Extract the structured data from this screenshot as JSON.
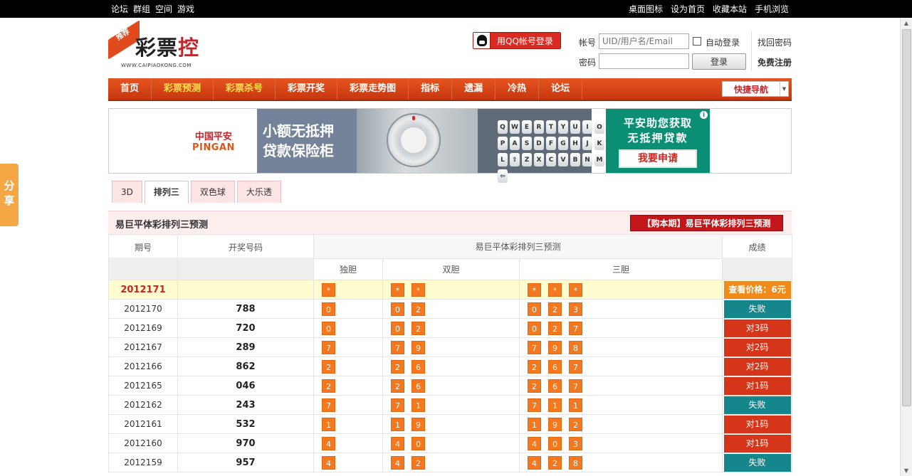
{
  "topbar": {
    "left": [
      "论坛",
      "群组",
      "空间",
      "游戏"
    ],
    "right": [
      "桌面图标",
      "设为首页",
      "收藏本站",
      "手机浏览"
    ]
  },
  "logo": {
    "badge": "推荐",
    "name_a": "彩票",
    "name_b": "控",
    "url": "WWW.CAIPIAOKONG.COM"
  },
  "login": {
    "qq_label": "用QQ帐号登录",
    "account_label": "帐号",
    "account_placeholder": "UID/用户名/Email",
    "password_label": "密码",
    "auto_login": "自动登录",
    "login_button": "登录",
    "find_password": "找回密码",
    "register": "免费注册"
  },
  "nav": {
    "items": [
      "首页",
      "彩票预测",
      "彩票杀号",
      "彩票开奖",
      "彩票走势图",
      "指标",
      "遗漏",
      "冷热",
      "论坛"
    ],
    "quick_nav": "快捷导航"
  },
  "banner": {
    "logo_cn": "中国平安",
    "logo_en": "PINGAN",
    "slogan_1": "小额无抵押",
    "slogan_2": "贷款保险柜",
    "keys": [
      "Q",
      "W",
      "E",
      "R",
      "T",
      "Y",
      "U",
      "I",
      "O",
      "P",
      "A",
      "S",
      "D",
      "F",
      "G",
      "H",
      "J",
      "K",
      "L",
      "⇧",
      "Z",
      "X",
      "C",
      "V",
      "B",
      "N",
      "M",
      "⇦"
    ],
    "cta_1": "平安助您获取",
    "cta_2": "无抵押贷款",
    "apply": "我要申请",
    "info": "i"
  },
  "share": "分享",
  "tabs": [
    "3D",
    "排列三",
    "双色球",
    "大乐透"
  ],
  "section": {
    "title": "易巨平体彩排列三预测",
    "buy": "【购本期】易巨平体彩排列三预测"
  },
  "table": {
    "h_issue": "期号",
    "h_draw": "开奖号码",
    "h_predict": "易巨平体彩排列三预测",
    "h_result": "成绩",
    "h_single": "独胆",
    "h_double": "双胆",
    "h_triple": "三胆",
    "current": {
      "issue": "2012171",
      "single": [
        "*"
      ],
      "double": [
        "*",
        "*"
      ],
      "triple": [
        "*",
        "*",
        "*"
      ],
      "result": "查看价格：6元"
    },
    "rows": [
      {
        "issue": "2012170",
        "draw": "788",
        "single": [
          "0"
        ],
        "double": [
          "0",
          "2"
        ],
        "triple": [
          "0",
          "2",
          "3"
        ],
        "result": "失败",
        "type": "fail"
      },
      {
        "issue": "2012169",
        "draw": "720",
        "single": [
          "0"
        ],
        "double": [
          "0",
          "2"
        ],
        "triple": [
          "0",
          "2",
          "7"
        ],
        "result": "对3码",
        "type": "hit"
      },
      {
        "issue": "2012167",
        "draw": "289",
        "single": [
          "7"
        ],
        "double": [
          "7",
          "9"
        ],
        "triple": [
          "7",
          "9",
          "8"
        ],
        "result": "对2码",
        "type": "hit"
      },
      {
        "issue": "2012166",
        "draw": "862",
        "single": [
          "2"
        ],
        "double": [
          "2",
          "6"
        ],
        "triple": [
          "2",
          "6",
          "7"
        ],
        "result": "对2码",
        "type": "hit"
      },
      {
        "issue": "2012165",
        "draw": "046",
        "single": [
          "2"
        ],
        "double": [
          "2",
          "6"
        ],
        "triple": [
          "2",
          "6",
          "7"
        ],
        "result": "对1码",
        "type": "hit"
      },
      {
        "issue": "2012162",
        "draw": "243",
        "single": [
          "7"
        ],
        "double": [
          "7",
          "1"
        ],
        "triple": [
          "7",
          "1",
          "1"
        ],
        "result": "失败",
        "type": "fail"
      },
      {
        "issue": "2012161",
        "draw": "532",
        "single": [
          "1"
        ],
        "double": [
          "1",
          "9"
        ],
        "triple": [
          "1",
          "9",
          "2"
        ],
        "result": "对1码",
        "type": "hit"
      },
      {
        "issue": "2012160",
        "draw": "970",
        "single": [
          "4"
        ],
        "double": [
          "4",
          "0"
        ],
        "triple": [
          "4",
          "0",
          "3"
        ],
        "result": "对1码",
        "type": "hit"
      },
      {
        "issue": "2012159",
        "draw": "957",
        "single": [
          "4"
        ],
        "double": [
          "4",
          "2"
        ],
        "triple": [
          "4",
          "2",
          "8"
        ],
        "result": "失败",
        "type": "fail"
      }
    ]
  }
}
